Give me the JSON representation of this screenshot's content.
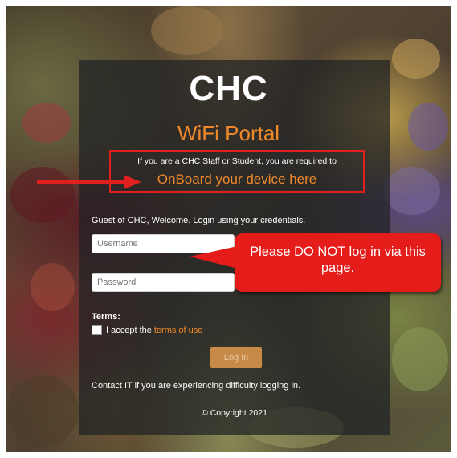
{
  "portal": {
    "logo": "CHC",
    "title": "WiFi Portal",
    "staff_note": "If you are a CHC Staff or Student, you are required to",
    "onboard_link": "OnBoard your device here",
    "guest_text": "Guest of CHC, Welcome. Login using your credentials.",
    "username_placeholder": "Username",
    "password_placeholder": "Password",
    "terms_label": "Terms:",
    "accept_prefix": "I accept the",
    "terms_link": "terms of use",
    "login_button": "Log In",
    "contact_text": "Contact IT if you are experiencing difficulty logging in.",
    "copyright": "© Copyright 2021"
  },
  "annotation": {
    "callout_text": "Please DO NOT log in via this page."
  },
  "colors": {
    "accent": "#f0892a",
    "annotation_red": "#e41d1b",
    "panel_bg": "#1e2124"
  }
}
